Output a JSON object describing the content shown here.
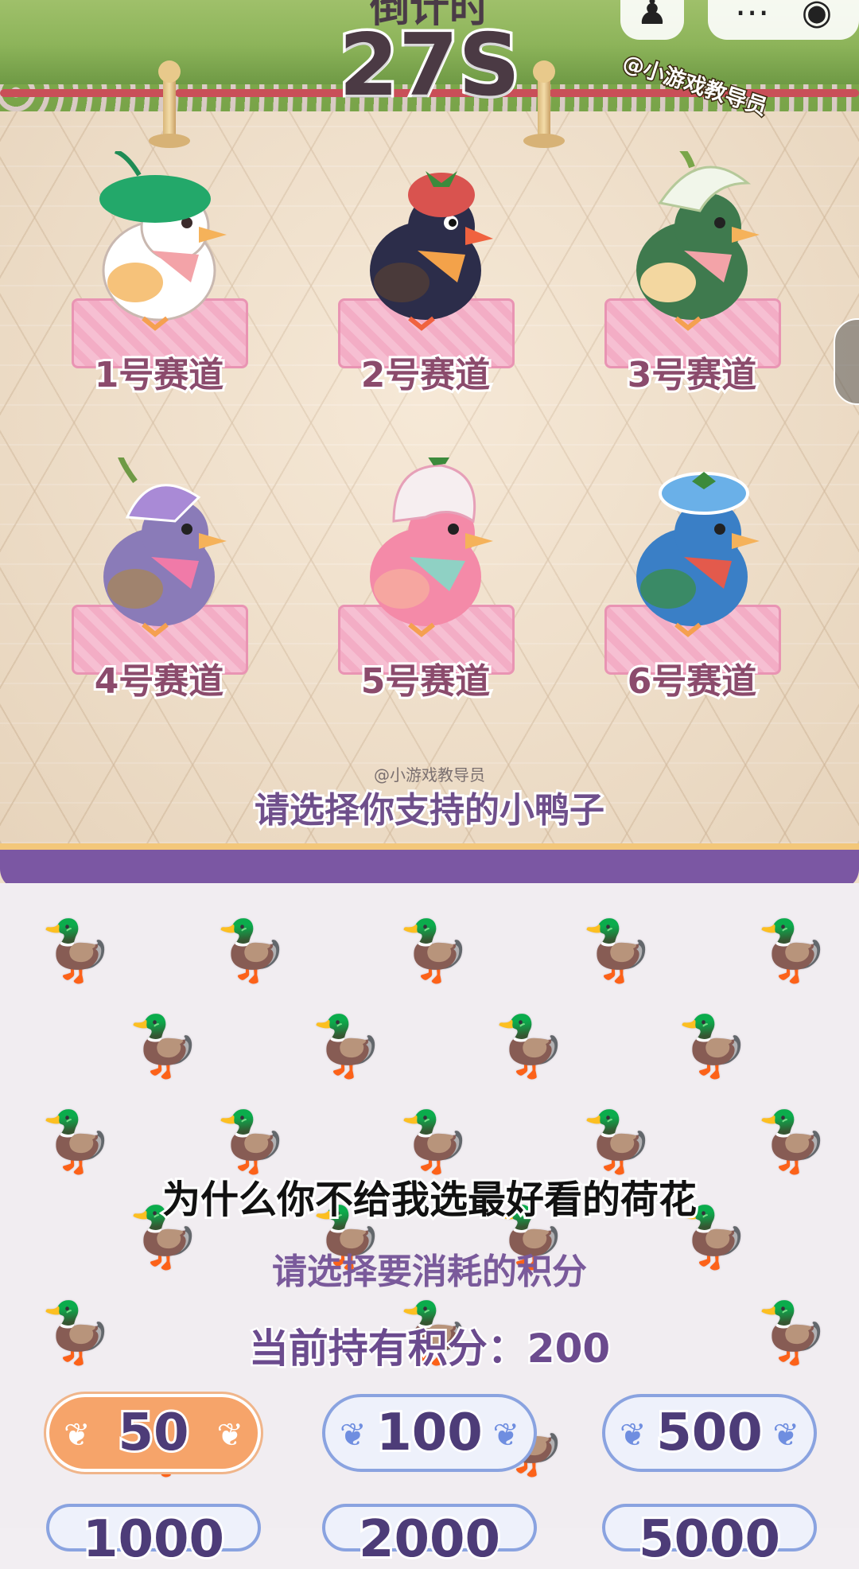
{
  "header": {
    "timer_label": "倒计时",
    "timer": "27S",
    "watermark": "@小游戏教导员",
    "menu_icon": "more-dots-icon",
    "close_icon": "target-circle-icon"
  },
  "lanes": [
    {
      "label": "1号赛道",
      "hat": "lotus-leaf-hat",
      "body": "#ffffff",
      "hat_color": "#23a86a"
    },
    {
      "label": "2号赛道",
      "hat": "strawberry-hat",
      "body": "#2c2d4a",
      "hat_color": "#d9534f"
    },
    {
      "label": "3号赛道",
      "hat": "lily-hat",
      "body": "#3f7a4e",
      "hat_color": "#f1f6ea"
    },
    {
      "label": "4号赛道",
      "hat": "morning-glory-hat",
      "body": "#8a7bb8",
      "hat_color": "#a98ad6"
    },
    {
      "label": "5号赛道",
      "hat": "bellflower-hat",
      "body": "#f48aa8",
      "hat_color": "#f6eef0"
    },
    {
      "label": "6号赛道",
      "hat": "blue-flower-hat",
      "body": "#3a7fc6",
      "hat_color": "#6ab0e8"
    }
  ],
  "field": {
    "small_watermark": "@小游戏教导员",
    "choose_prompt": "请选择你支持的小鸭子"
  },
  "panel": {
    "subtitle": "为什么你不给我选最好看的荷花",
    "prompt": "请选择要消耗的积分",
    "points": "当前持有积分：200",
    "options": [
      "50",
      "100",
      "500"
    ],
    "options_cut": [
      "1000",
      "2000",
      "5000"
    ],
    "selected": "50"
  },
  "colors": {
    "accent": "#7b57a3",
    "selected": "#f6a46a",
    "label": "#8b4b6c"
  }
}
